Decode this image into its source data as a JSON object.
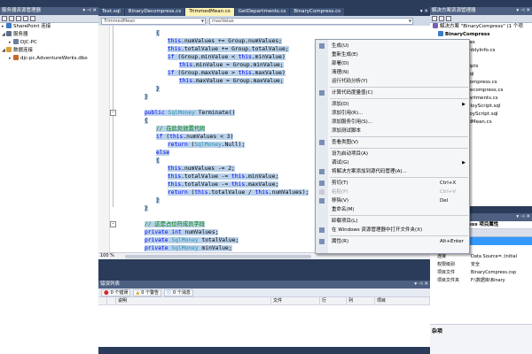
{
  "left_panel": {
    "title": "服务器资源管理器",
    "tree": [
      {
        "label": "SharePoint 连接",
        "indent": 0,
        "twist": "▸",
        "icon": "sharepoint-icon",
        "color": "#3a78c8"
      },
      {
        "label": "服务器",
        "indent": 0,
        "twist": "◢",
        "icon": "server-icon",
        "color": "#5a6e8a"
      },
      {
        "label": "DJC-PC",
        "indent": 1,
        "twist": "▸",
        "icon": "computer-icon",
        "color": "#6a7fa0"
      },
      {
        "label": "数据连接",
        "indent": 0,
        "twist": "◢",
        "icon": "data-connection-icon",
        "color": "#d8a23a"
      },
      {
        "label": "djc-pc.AdventureWorks.dbo",
        "indent": 1,
        "twist": "▸",
        "icon": "database-icon",
        "color": "#c86a2a"
      }
    ]
  },
  "tabs": [
    {
      "label": "Text.sql",
      "state": "normal"
    },
    {
      "label": "BinaryDecompress.cs",
      "state": "normal"
    },
    {
      "label": "TrimmedMean.cs",
      "state": "active"
    },
    {
      "label": "GetDepartments.cs",
      "state": "normal"
    },
    {
      "label": "BinaryCompress.cs",
      "state": "normal"
    }
  ],
  "nav": {
    "class_combo": "TrimmedMean",
    "member_combo": "maxValue"
  },
  "code_lines": [
    {
      "text": "{",
      "indent": 3,
      "sel": true
    },
    {
      "text": "this.numValues += Group.numValues;",
      "indent": 4,
      "sel": true
    },
    {
      "text": "this.totalValue += Group.totalValue;",
      "indent": 4,
      "sel": true
    },
    {
      "text": "if (Group.minValue < this.minValue)",
      "indent": 4,
      "sel": true
    },
    {
      "text": "this.minValue = Group.minValue;",
      "indent": 5,
      "sel": true
    },
    {
      "text": "if (Group.maxValue > this.maxValue)",
      "indent": 4,
      "sel": true
    },
    {
      "text": "this.maxValue = Group.maxValue;",
      "indent": 5,
      "sel": true
    },
    {
      "text": "}",
      "indent": 3,
      "sel": true
    },
    {
      "text": "}",
      "indent": 2,
      "sel": true
    },
    {
      "text": "",
      "indent": 0,
      "sel": false
    },
    {
      "text": "public SqlMoney Terminate()",
      "indent": 2,
      "sel": true
    },
    {
      "text": "{",
      "indent": 2,
      "sel": true
    },
    {
      "text": "// 在此处放置代码",
      "indent": 3,
      "sel": true
    },
    {
      "text": "if (this.numValues < 3)",
      "indent": 3,
      "sel": true
    },
    {
      "text": "return (SqlMoney.Null);",
      "indent": 4,
      "sel": true
    },
    {
      "text": "else",
      "indent": 3,
      "sel": true
    },
    {
      "text": "{",
      "indent": 3,
      "sel": true
    },
    {
      "text": "this.numValues -= 2;",
      "indent": 4,
      "sel": true
    },
    {
      "text": "this.totalValue -= this.minValue;",
      "indent": 4,
      "sel": true
    },
    {
      "text": "this.totalValue -= this.maxValue;",
      "indent": 4,
      "sel": true
    },
    {
      "text": "return (this.totalValue / this.numValues);",
      "indent": 4,
      "sel": true
    },
    {
      "text": "}",
      "indent": 3,
      "sel": true
    },
    {
      "text": "}",
      "indent": 2,
      "sel": true
    },
    {
      "text": "",
      "indent": 0,
      "sel": false
    },
    {
      "text": "// 这是占位符成员字段",
      "indent": 2,
      "sel": true
    },
    {
      "text": "private int numValues;",
      "indent": 2,
      "sel": true
    },
    {
      "text": "private SqlMoney totalValue;",
      "indent": 2,
      "sel": true
    },
    {
      "text": "private SqlMoney minValue;",
      "indent": 2,
      "sel": true
    },
    {
      "text": "private SqlMoney maxValue;",
      "indent": 2,
      "sel": true
    }
  ],
  "zoom": "100 %",
  "context_menu": [
    {
      "label": "生成(U)",
      "icon": "build-icon"
    },
    {
      "label": "重新生成(E)"
    },
    {
      "label": "部署(D)"
    },
    {
      "label": "清理(N)"
    },
    {
      "label": "运行代码分析(Y)"
    },
    {
      "sep": true
    },
    {
      "label": "计算代码度量值(C)",
      "icon": "metrics-icon"
    },
    {
      "sep": true
    },
    {
      "label": "添加(D)",
      "submenu": true
    },
    {
      "label": "添加引用(R)..."
    },
    {
      "label": "添加服务引用(S)..."
    },
    {
      "label": "添加测试脚本"
    },
    {
      "sep": true
    },
    {
      "label": "查看类图(V)",
      "icon": "class-diagram-icon"
    },
    {
      "sep": true
    },
    {
      "label": "设为启动项目(A)"
    },
    {
      "label": "调试(G)",
      "submenu": true
    },
    {
      "label": "将解决方案添加到源代码管理(A)...",
      "icon": "source-control-icon"
    },
    {
      "sep": true
    },
    {
      "label": "剪切(T)",
      "shortcut": "Ctrl+X",
      "icon": "cut-icon"
    },
    {
      "label": "粘贴(P)",
      "shortcut": "Ctrl+V",
      "icon": "paste-icon",
      "disabled": true
    },
    {
      "label": "移除(V)",
      "shortcut": "Del",
      "icon": "remove-icon"
    },
    {
      "label": "重命名(M)"
    },
    {
      "sep": true
    },
    {
      "label": "卸载项目(L)"
    },
    {
      "label": "在 Windows 资源管理器中打开文件夹(X)",
      "icon": "folder-icon"
    },
    {
      "sep": true
    },
    {
      "label": "属性(R)",
      "shortcut": "Alt+Enter",
      "icon": "properties-icon"
    }
  ],
  "error_list": {
    "title": "错误列表",
    "errors_btn": "0 个错误",
    "warnings_btn": "0 个警告",
    "messages_btn": "0 个消息",
    "columns": [
      "说明",
      "文件",
      "行",
      "列",
      "项目"
    ]
  },
  "solution_explorer": {
    "title": "解决方案资源管理器",
    "items": [
      {
        "label": "解决方案 \"BinaryCompress\" (1 个项",
        "indent": 0
      },
      {
        "label": "BinaryCompress",
        "indent": 1,
        "bold": true
      },
      {
        "label": "Properties",
        "indent": 2
      },
      {
        "label": "AssemblyInfo.cs",
        "indent": 3
      },
      {
        "label": "引用",
        "indent": 2
      },
      {
        "label": "Test Scripts",
        "indent": 2
      },
      {
        "label": "Test.sql",
        "indent": 3
      },
      {
        "label": "BinaryCompress.cs",
        "indent": 2
      },
      {
        "label": "BinaryDecompress.cs",
        "indent": 2
      },
      {
        "label": "GetDepartments.cs",
        "indent": 2
      },
      {
        "label": "PostDeployScript.sql",
        "indent": 2
      },
      {
        "label": "PreDeployScript.sql",
        "indent": 2
      },
      {
        "label": "TrimmedMean.cs",
        "indent": 2
      }
    ]
  },
  "properties": {
    "title": "属性",
    "object": "BinaryCompress 项目属性",
    "category": "杂项",
    "rows": [
      {
        "k": "程序集所有者",
        "v": ""
      },
      {
        "k": "连接",
        "v": "Data Source=.;Initial"
      },
      {
        "k": "权限级别",
        "v": "安全"
      },
      {
        "k": "项目文件",
        "v": "BinaryCompress.csp"
      },
      {
        "k": "项目文件夹",
        "v": "F:\\数据库\\Binary"
      }
    ],
    "desc_title": "杂项"
  },
  "colors": {
    "vs_dark": "#2b3c5a",
    "tab_active": "#fff3b4",
    "selection": "#b9d1ea"
  }
}
